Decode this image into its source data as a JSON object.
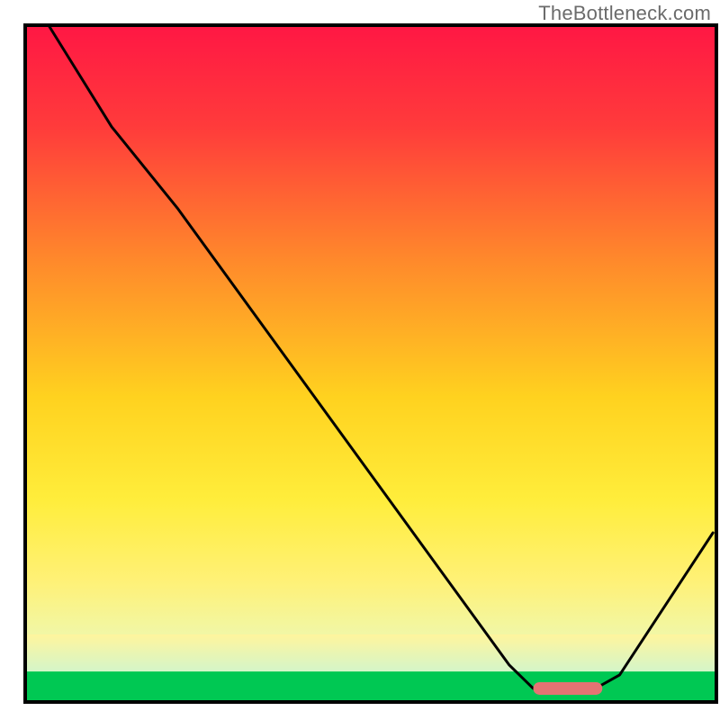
{
  "watermark": "TheBottleneck.com",
  "chart_data": {
    "type": "line",
    "title": "",
    "xlabel": "",
    "ylabel": "",
    "xlim": [
      0,
      100
    ],
    "ylim": [
      0,
      100
    ],
    "gradient_stops": [
      {
        "offset": 0,
        "color": "#ff1744"
      },
      {
        "offset": 15,
        "color": "#ff3b3b"
      },
      {
        "offset": 35,
        "color": "#ff8a2b"
      },
      {
        "offset": 55,
        "color": "#ffd21f"
      },
      {
        "offset": 70,
        "color": "#ffed3b"
      },
      {
        "offset": 82,
        "color": "#fff176"
      },
      {
        "offset": 90,
        "color": "#f1f7a6"
      },
      {
        "offset": 96,
        "color": "#7fe07a"
      },
      {
        "offset": 100,
        "color": "#00c853"
      }
    ],
    "green_band": {
      "top_fraction": 0.955,
      "bottom_fraction": 1.0,
      "color": "#00c853"
    },
    "pale_band": {
      "top_fraction": 0.9,
      "bottom_fraction": 0.955
    },
    "series": [
      {
        "name": "curve",
        "x": [
          3.5,
          12.5,
          22.0,
          70.0,
          73.5,
          82.5,
          86.0,
          99.5
        ],
        "y": [
          99.8,
          85.0,
          73.0,
          5.5,
          2.0,
          2.0,
          4.0,
          25.0
        ]
      }
    ],
    "marker": {
      "x_start": 73.5,
      "x_end": 83.5,
      "y": 2.0,
      "color": "#e57373",
      "thickness": 14,
      "radius": 7
    },
    "frame_color": "#000000",
    "frame_left_fraction": 0.035,
    "frame_right_fraction": 0.995,
    "frame_top_fraction": 0.035,
    "frame_bottom_fraction": 0.975
  }
}
